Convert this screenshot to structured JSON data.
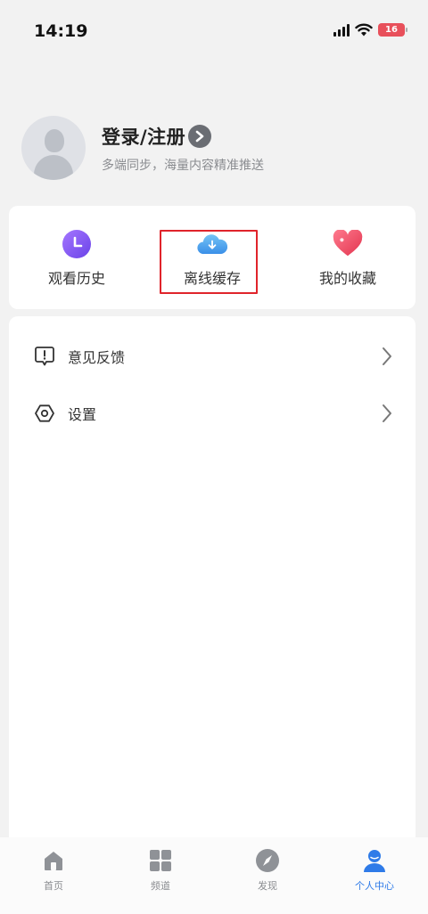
{
  "status_bar": {
    "time": "14:19",
    "battery": "16"
  },
  "profile": {
    "login_label": "登录/注册",
    "subtitle": "多端同步，海量内容精准推送"
  },
  "quick_actions": [
    {
      "label": "观看历史",
      "icon": "clock-icon",
      "color": "#8a5cf6"
    },
    {
      "label": "离线缓存",
      "icon": "cloud-download-icon",
      "color": "#4aa3ee"
    },
    {
      "label": "我的收藏",
      "icon": "heart-icon",
      "color": "#ee4f6a"
    }
  ],
  "menu": [
    {
      "label": "意见反馈",
      "icon": "feedback-icon"
    },
    {
      "label": "设置",
      "icon": "settings-icon"
    }
  ],
  "tab_bar": [
    {
      "label": "首页",
      "icon": "home-icon",
      "active": false
    },
    {
      "label": "频道",
      "icon": "grid-icon",
      "active": false
    },
    {
      "label": "发现",
      "icon": "compass-icon",
      "active": false
    },
    {
      "label": "个人中心",
      "icon": "person-icon",
      "active": true
    }
  ],
  "colors": {
    "accent": "#2f7be8",
    "highlight_box": "#e0242b",
    "background": "#f2f2f2"
  }
}
